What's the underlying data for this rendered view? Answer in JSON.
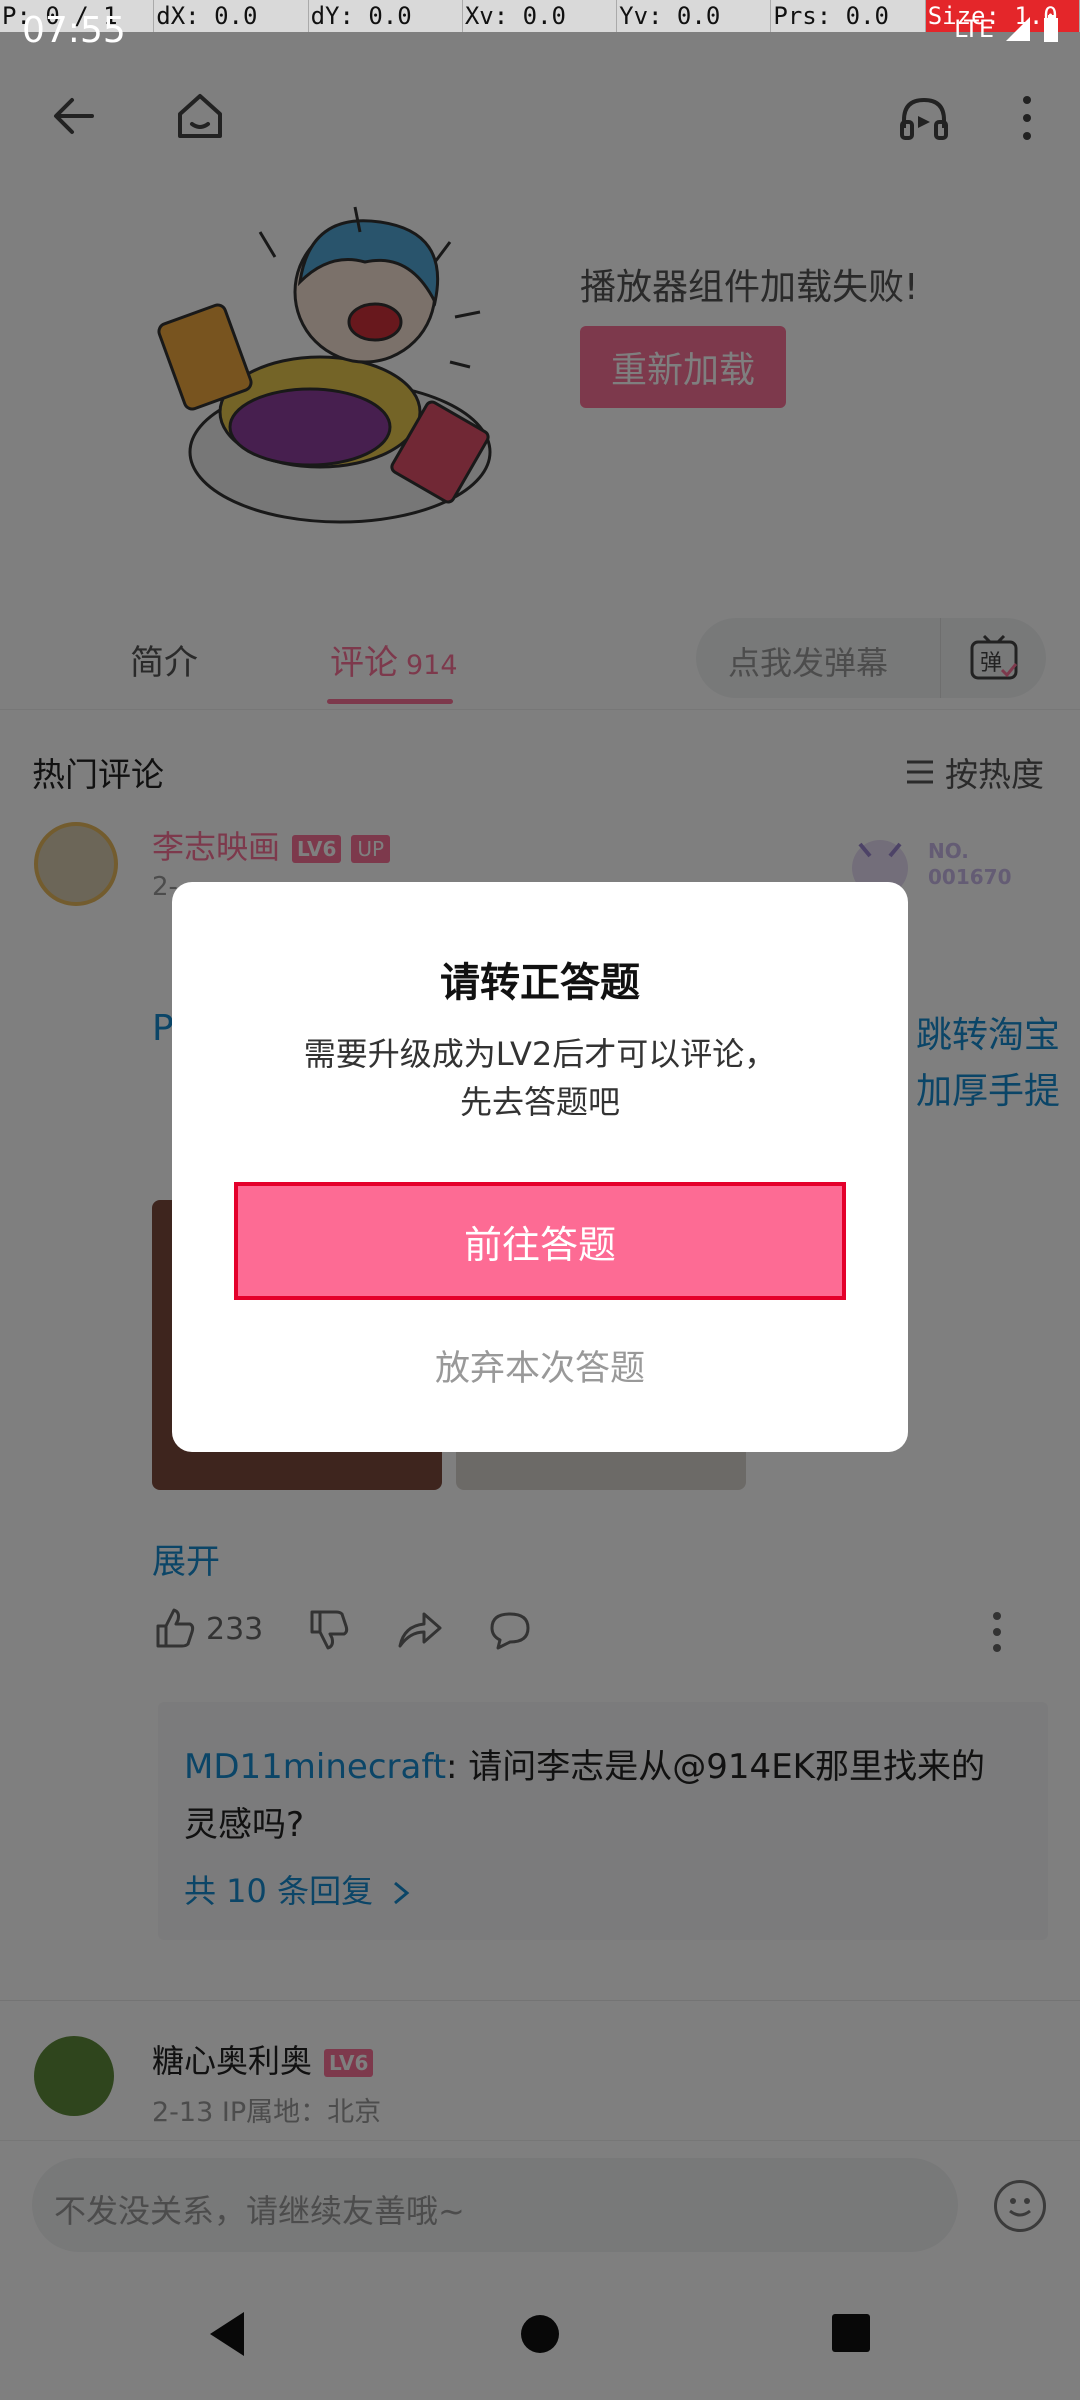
{
  "debug_bar": {
    "p": "P: 0 / 1",
    "dx": "dX: 0.0",
    "dy": "dY: 0.0",
    "xv": "Xv: 0.0",
    "yv": "Yv: 0.0",
    "prs": "Prs: 0.0",
    "size": "Size: 1.0"
  },
  "status_bar": {
    "time": "07:55",
    "network": "LTE"
  },
  "player": {
    "error_message": "播放器组件加载失败!",
    "reload_label": "重新加载"
  },
  "tabs": {
    "intro": "简介",
    "comments": "评论",
    "comments_count": "914",
    "danmaku_placeholder": "点我发弹幕",
    "danmaku_button": "弹"
  },
  "comments": {
    "section_title": "热门评论",
    "sort_label": "按热度",
    "items": [
      {
        "user": "李志映画",
        "level": "LV6",
        "up_badge": "UP",
        "date": "2-…",
        "fan_badge_no": "NO.",
        "fan_badge_num": "001670",
        "text_left": "P",
        "text_right_1": "跳转淘宝",
        "text_right_2": "加厚手提",
        "expand_label": "展开",
        "likes": "233"
      }
    ],
    "reply_preview": {
      "user": "MD11minecraft",
      "text": ": 请问李志是从@914EK那里找来的灵感吗?",
      "more_label": "共 10 条回复"
    },
    "second": {
      "user": "糖心奥利奥",
      "level": "LV6",
      "date": "2-13  IP属地：北京"
    }
  },
  "input": {
    "placeholder": "不发没关系，请继续友善哦~"
  },
  "dialog": {
    "title": "请转正答题",
    "body_line1": "需要升级成为LV2后才可以评论，",
    "body_line2": "先去答题吧",
    "primary_label": "前往答题",
    "secondary_label": "放弃本次答题"
  },
  "colors": {
    "accent": "#fb7299",
    "link": "#178bcf",
    "highlight_border": "#e4002b"
  }
}
